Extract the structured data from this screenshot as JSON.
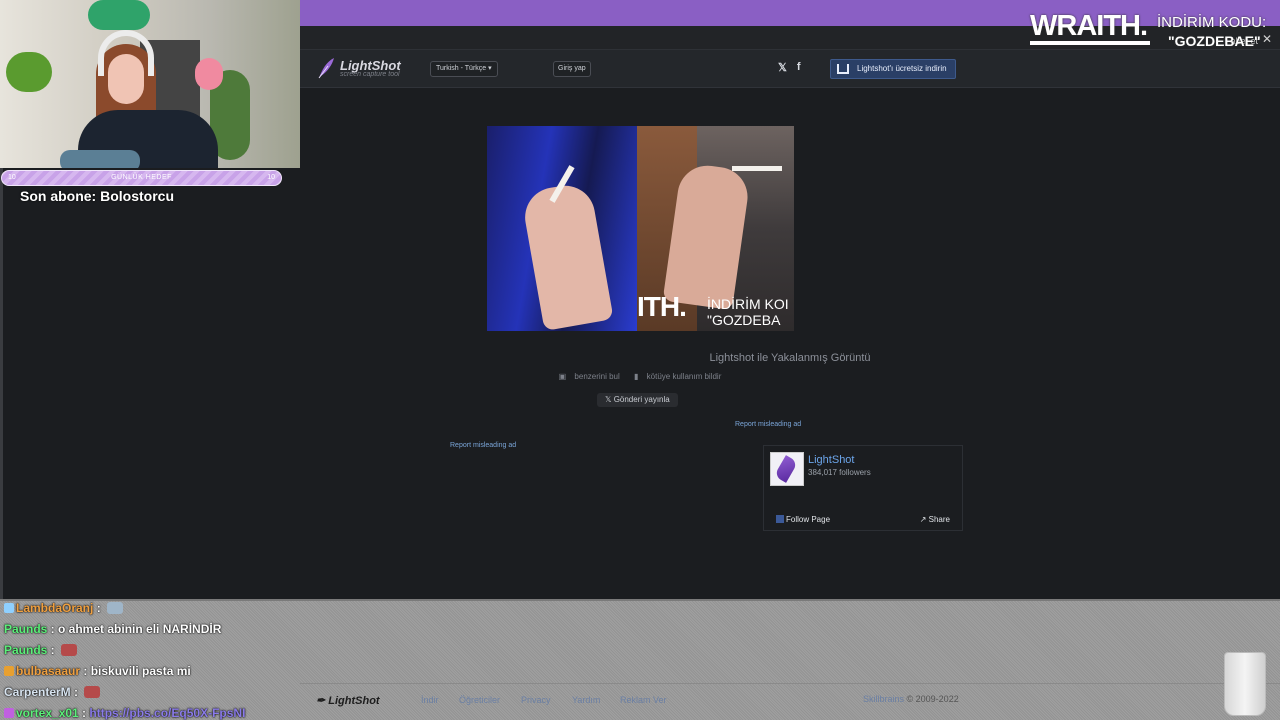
{
  "stream_overlay": {
    "goal": {
      "label": "GÜNLÜK HEDEF",
      "current": "10",
      "target": "10"
    },
    "last_sub": "Son abone: Bolostorcu",
    "ad": {
      "brand": "WRAITH.",
      "code_label": "İNDİRİM KODU:",
      "code_value": "\"GOZDEBAE\""
    }
  },
  "tabstrip": {
    "share_text": "abet et",
    "close_glyph": "✕"
  },
  "lightshot": {
    "logo_name": "LightShot",
    "logo_tagline": "screen capture tool",
    "language_select": "Turkish - Türkçe",
    "login_button": "Giriş yap",
    "social": [
      "twitter-icon",
      "facebook-icon"
    ],
    "download_button": "Lightshot'ı ücretsiz indirin",
    "image_watermark": "ITH.",
    "image_watermark_text": "İNDİRİM KOI\n\"GOZDEBA",
    "caption": "Lightshot ile Yakalanmış Görüntü",
    "action_similar": "benzerini bul",
    "action_report": "kötüye kullanım bildir",
    "tweet_button": "Gönderi yayınla",
    "report_ad_1": "Report misleading ad",
    "report_ad_2": "Report misleading ad",
    "fb": {
      "page_name": "LightShot",
      "followers": "384,017 followers",
      "follow": "Follow Page",
      "share": "Share"
    },
    "footer": {
      "logo": "LightShot",
      "links": [
        "İndir",
        "Öğreticiler",
        "Privacy",
        "Yardım",
        "Reklam Ver"
      ],
      "copyright_link": "Skillbrains",
      "copyright_text": "© 2009-2022"
    }
  },
  "chat": [
    {
      "user": "LambdaOranj",
      "color": "#f0a040",
      "text": "",
      "badge": "#8fd0ff",
      "emote": "#9fb5c8"
    },
    {
      "user": "Paunds",
      "color": "#5cf07a",
      "text": "o ahmet abinin eli NARİNDİR",
      "badge": "",
      "emote": ""
    },
    {
      "user": "Paunds",
      "color": "#5cf07a",
      "text": "",
      "badge": "",
      "emote": "#b54a4a"
    },
    {
      "user": "bulbasaaur",
      "color": "#f0a040",
      "text": "biskuvili pasta mi",
      "badge": "#e8a030",
      "emote": ""
    },
    {
      "user": "CarpenterM",
      "color": "#d8e4f0",
      "text": "",
      "badge": "",
      "emote": "#b54a4a"
    },
    {
      "user": "vortex_x01",
      "color": "#5cf07a",
      "text": "https://pbs.co/Eq50X-FpsNI",
      "badge": "#c060e0",
      "emote": ""
    }
  ],
  "colors": {
    "accent": "#8a5fc4",
    "page_bg": "#1b1d20",
    "link": "#7aa5d8"
  }
}
